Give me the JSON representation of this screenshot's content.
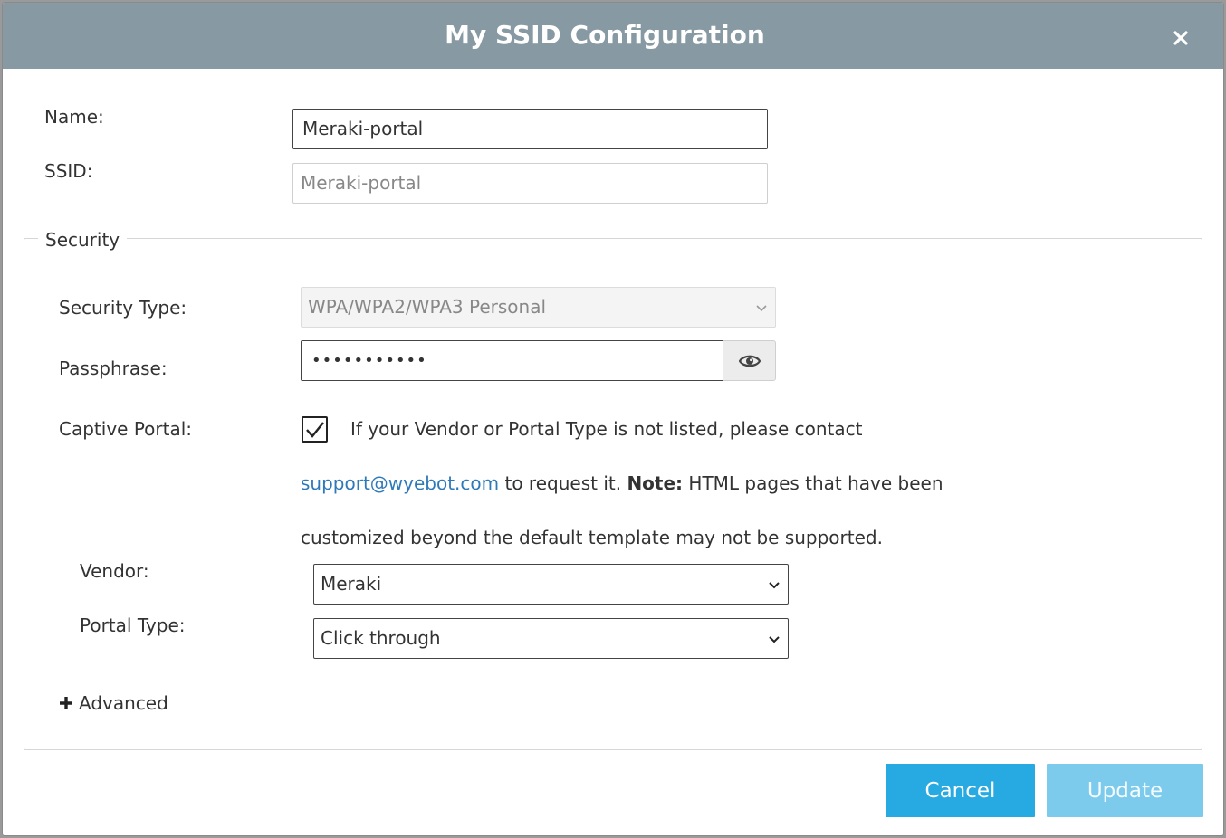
{
  "dialog": {
    "title": "My SSID Configuration",
    "close_icon": "close-icon"
  },
  "name_field": {
    "label": "Name:",
    "value": "Meraki-portal"
  },
  "ssid_field": {
    "label": "SSID:",
    "value": "Meraki-portal"
  },
  "security": {
    "legend": "Security",
    "security_type": {
      "label": "Security Type:",
      "value": "WPA/WPA2/WPA3 Personal"
    },
    "passphrase": {
      "label": "Passphrase:",
      "value": "•••••••••••",
      "toggle_icon": "eye-icon"
    },
    "captive_portal": {
      "label": "Captive Portal:",
      "checked": true,
      "info_line1": "If your Vendor or Portal Type is not listed, please contact",
      "info_link": "support@wyebot.com",
      "info_line2_mid": " to request it. ",
      "info_note_bold": "Note:",
      "info_line2_end": " HTML pages that have been",
      "info_line3": "customized beyond the default template may not be supported."
    },
    "vendor": {
      "label": "Vendor:",
      "value": "Meraki"
    },
    "portal_type": {
      "label": "Portal Type:",
      "value": "Click through"
    },
    "advanced": {
      "label": "Advanced",
      "icon": "plus-icon"
    }
  },
  "footer": {
    "cancel_label": "Cancel",
    "update_label": "Update"
  },
  "colors": {
    "header_bg": "#8799a2",
    "primary_button": "#27a9e1",
    "disabled_button": "#7ccbec",
    "link": "#2e79b9"
  }
}
